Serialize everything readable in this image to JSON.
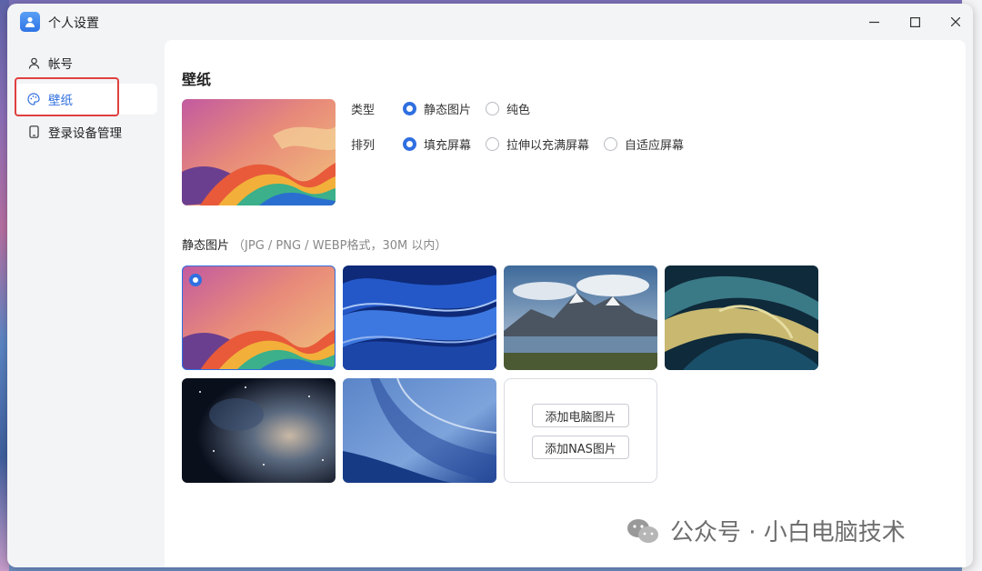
{
  "window": {
    "title": "个人设置"
  },
  "sidebar": {
    "items": [
      {
        "label": "帐号",
        "icon": "user-icon"
      },
      {
        "label": "壁纸",
        "icon": "palette-icon",
        "active": true
      },
      {
        "label": "登录设备管理",
        "icon": "device-icon"
      }
    ]
  },
  "main": {
    "section_title": "壁纸",
    "type_row": {
      "label": "类型",
      "options": [
        "静态图片",
        "纯色"
      ],
      "selected": "静态图片"
    },
    "arrange_row": {
      "label": "排列",
      "options": [
        "填充屏幕",
        "拉伸以充满屏幕",
        "自适应屏幕"
      ],
      "selected": "填充屏幕"
    },
    "gallery": {
      "title": "静态图片",
      "hint": "（JPG / PNG / WEBP格式，30M 以内）",
      "thumbnails": [
        "rainbow-swirl",
        "blue-waves",
        "mountain-lake",
        "teal-gold-swirl",
        "nebula-space",
        "blue-curves"
      ],
      "selected_index": 0,
      "add_computer_label": "添加电脑图片",
      "add_nas_label": "添加NAS图片"
    }
  },
  "watermark": {
    "text": "公众号 · 小白电脑技术"
  },
  "colors": {
    "accent": "#2f6fe0",
    "highlight": "#e04040"
  }
}
